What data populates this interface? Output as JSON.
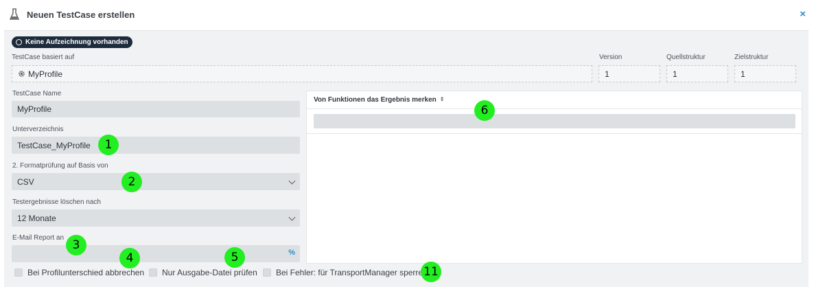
{
  "header": {
    "title": "Neuen TestCase erstellen",
    "close_symbol": "×"
  },
  "badge": {
    "label": "Keine Aufzeichnung vorhanden"
  },
  "based_on": {
    "label": "TestCase basiert auf",
    "value": "MyProfile"
  },
  "version": {
    "label": "Version",
    "value": "1"
  },
  "source": {
    "label": "Quellstruktur",
    "value": "1"
  },
  "target": {
    "label": "Zielstruktur",
    "value": "1"
  },
  "name": {
    "label": "TestCase Name",
    "value": "MyProfile"
  },
  "subdir": {
    "label": "Unterverzeichnis",
    "value": "TestCase_MyProfile"
  },
  "format_check": {
    "label": "2. Formatprüfung auf Basis von",
    "value": "CSV"
  },
  "delete_after": {
    "label": "Testergebnisse löschen nach",
    "value": "12 Monate"
  },
  "email": {
    "label": "E-Mail Report an",
    "value": ""
  },
  "functions": {
    "header": "Von Funktionen das Ergebnis merken",
    "sort_symbol": "⇕"
  },
  "checkboxes": [
    {
      "label": "Bei Profilunterschied abbrechen"
    },
    {
      "label": "Nur Ausgabe-Datei prüfen"
    },
    {
      "label": "Bei Fehler: für TransportManager sperren"
    }
  ],
  "markers": [
    "1",
    "2",
    "3",
    "4",
    "5",
    "6",
    "11"
  ],
  "colors": {
    "accent": "#2a8fc4",
    "badge_bg": "#1e2b3c",
    "marker": "#22ee22"
  }
}
